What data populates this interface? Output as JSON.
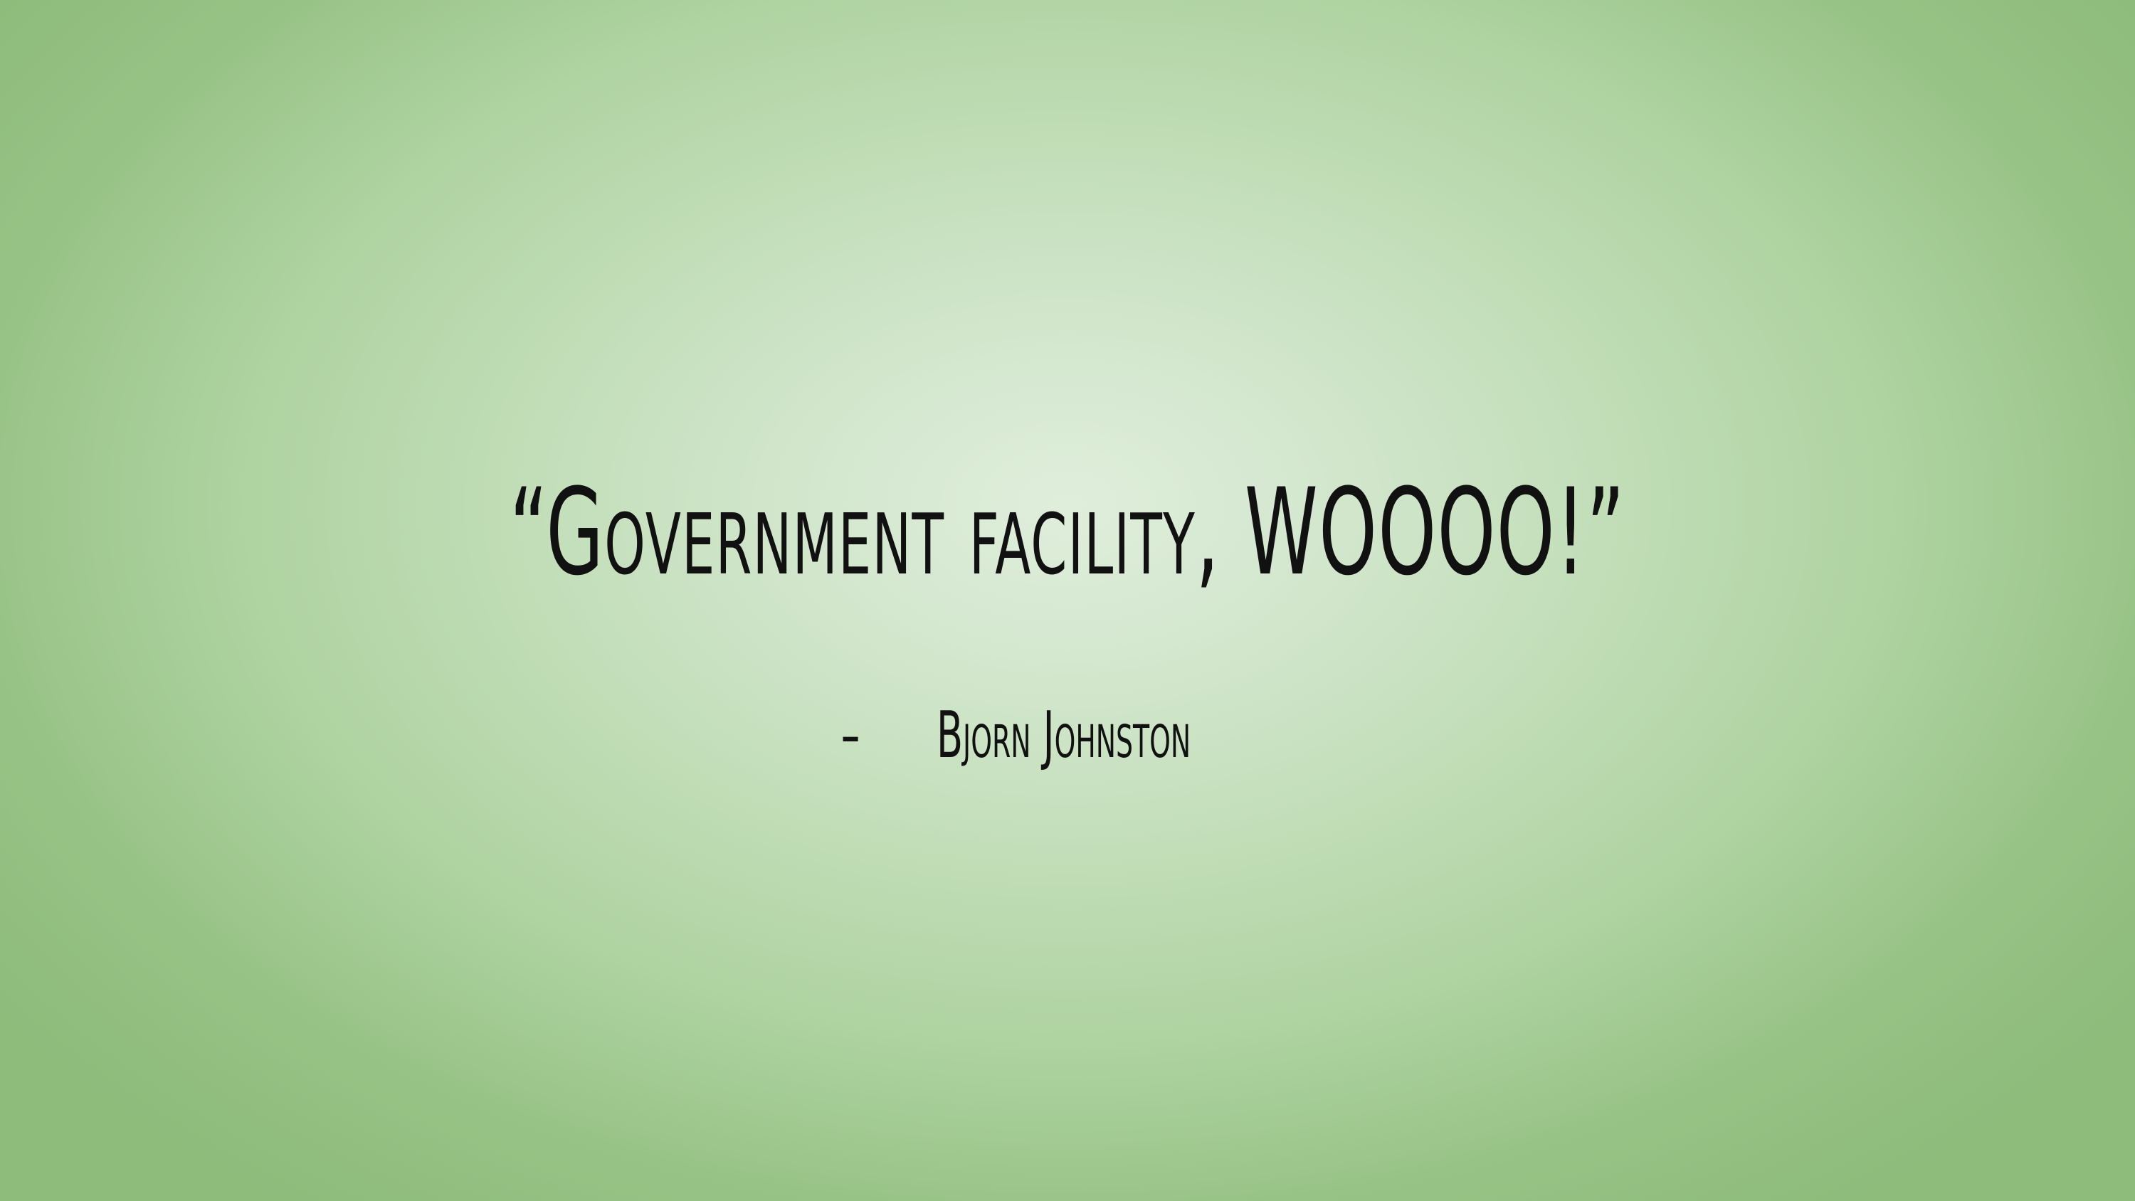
{
  "slide": {
    "quote": "“Government facility, WOOOO!”",
    "attribution_marker": "-",
    "author": "Bjorn Johnston"
  },
  "colors": {
    "background_center": "#dfeedb",
    "background_edge": "#8dbc7b",
    "text": "#111111"
  }
}
